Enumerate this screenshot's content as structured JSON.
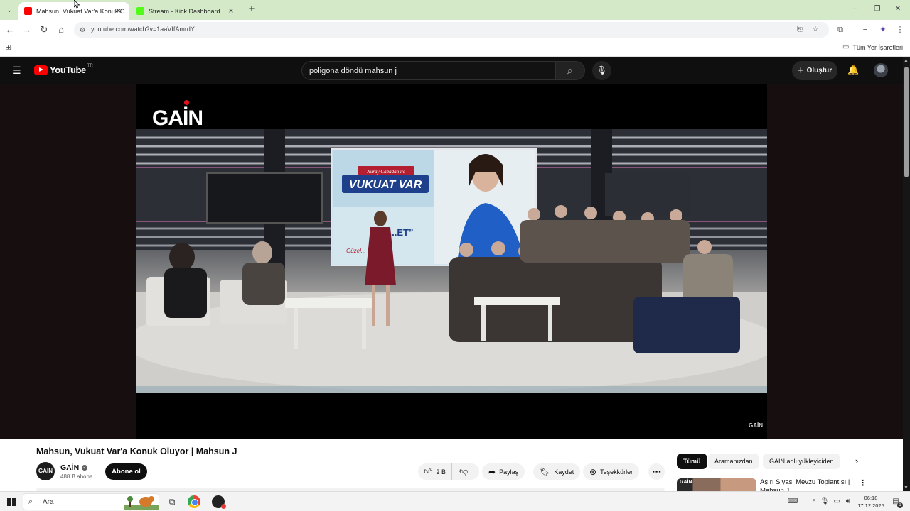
{
  "browser": {
    "tabs": [
      {
        "title": "Mahsun, Vukuat Var'a Konuk Ol",
        "favicon_color": "#ff0000",
        "active": true
      },
      {
        "title": "Stream - Kick Dashboard",
        "favicon_color": "#53fc18",
        "active": false
      }
    ],
    "url": "youtube.com/watch?v=1aaVIfAmrdY",
    "bookmarks_label": "Tüm Yer İşaretleri"
  },
  "youtube": {
    "logo_text": "YouTube",
    "region": "TR",
    "search_query": "poligona döndü mahsun j",
    "create_label": "Oluştur"
  },
  "player": {
    "watermark": "GAİN",
    "corner_watermark": "GAİN",
    "scene": {
      "show_logo_top": "Nuray Cabadan ile",
      "show_logo": "VUKUAT VAR",
      "screen_text": "“...ET”",
      "screen_subtext": "Güzel... ...zülüyor.."
    }
  },
  "video": {
    "title": "Mahsun, Vukuat Var'a Konuk Oluyor | Mahsun J",
    "channel_avatar_text": "GAİN",
    "channel_name": "GAİN",
    "subscribers": "488 B abone",
    "subscribe_label": "Abone ol",
    "likes": "2 B",
    "share_label": "Paylaş",
    "save_label": "Kaydet",
    "thanks_label": "Teşekkürler"
  },
  "recommendations": {
    "chips": [
      "Tümü",
      "Aramanızdan",
      "GAİN adlı yükleyiciden"
    ],
    "first": {
      "thumb_label": "GAİN",
      "title": "Aşırı Siyasi Mevzu Toplantısı | Mahsun J"
    }
  },
  "taskbar": {
    "search_placeholder": "Ara",
    "time": "06:18",
    "date": "17.12.2025",
    "notification_count": "1"
  },
  "colors": {
    "youtube_red": "#ff0000",
    "tabstrip_bg": "#d3e9c8",
    "yt_dark": "#0f0f0f"
  }
}
